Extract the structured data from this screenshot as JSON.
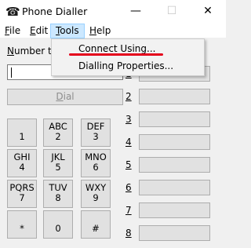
{
  "window": {
    "title": "Phone Dialler",
    "icon": "phone-icon",
    "minimize_glyph": "—",
    "maximize_glyph": "☐",
    "close_glyph": "✕"
  },
  "menu": {
    "file": {
      "underline": "F",
      "rest": "ile"
    },
    "edit": {
      "underline": "E",
      "rest": "dit"
    },
    "tools": {
      "underline": "T",
      "rest": "ools"
    },
    "help": {
      "underline": "H",
      "rest": "elp"
    }
  },
  "dropdown": {
    "items": [
      {
        "label": "Connect Using..."
      },
      {
        "label": "Dialling Properties..."
      }
    ],
    "highlight_color": "#e4001b"
  },
  "number": {
    "label_underline": "N",
    "label_rest": "umber to d"
  },
  "dial": {
    "underline": "D",
    "rest": "ial"
  },
  "keypad": [
    {
      "letters": "",
      "digit": "1"
    },
    {
      "letters": "ABC",
      "digit": "2"
    },
    {
      "letters": "DEF",
      "digit": "3"
    },
    {
      "letters": "GHI",
      "digit": "4"
    },
    {
      "letters": "JKL",
      "digit": "5"
    },
    {
      "letters": "MNO",
      "digit": "6"
    },
    {
      "letters": "PQRS",
      "digit": "7"
    },
    {
      "letters": "TUV",
      "digit": "8"
    },
    {
      "letters": "WXY",
      "digit": "9"
    },
    {
      "letters": "",
      "digit": "*"
    },
    {
      "letters": "",
      "digit": "0"
    },
    {
      "letters": "",
      "digit": "#"
    }
  ],
  "speed_dial": [
    "1",
    "2",
    "3",
    "4",
    "5",
    "6",
    "7",
    "8"
  ]
}
